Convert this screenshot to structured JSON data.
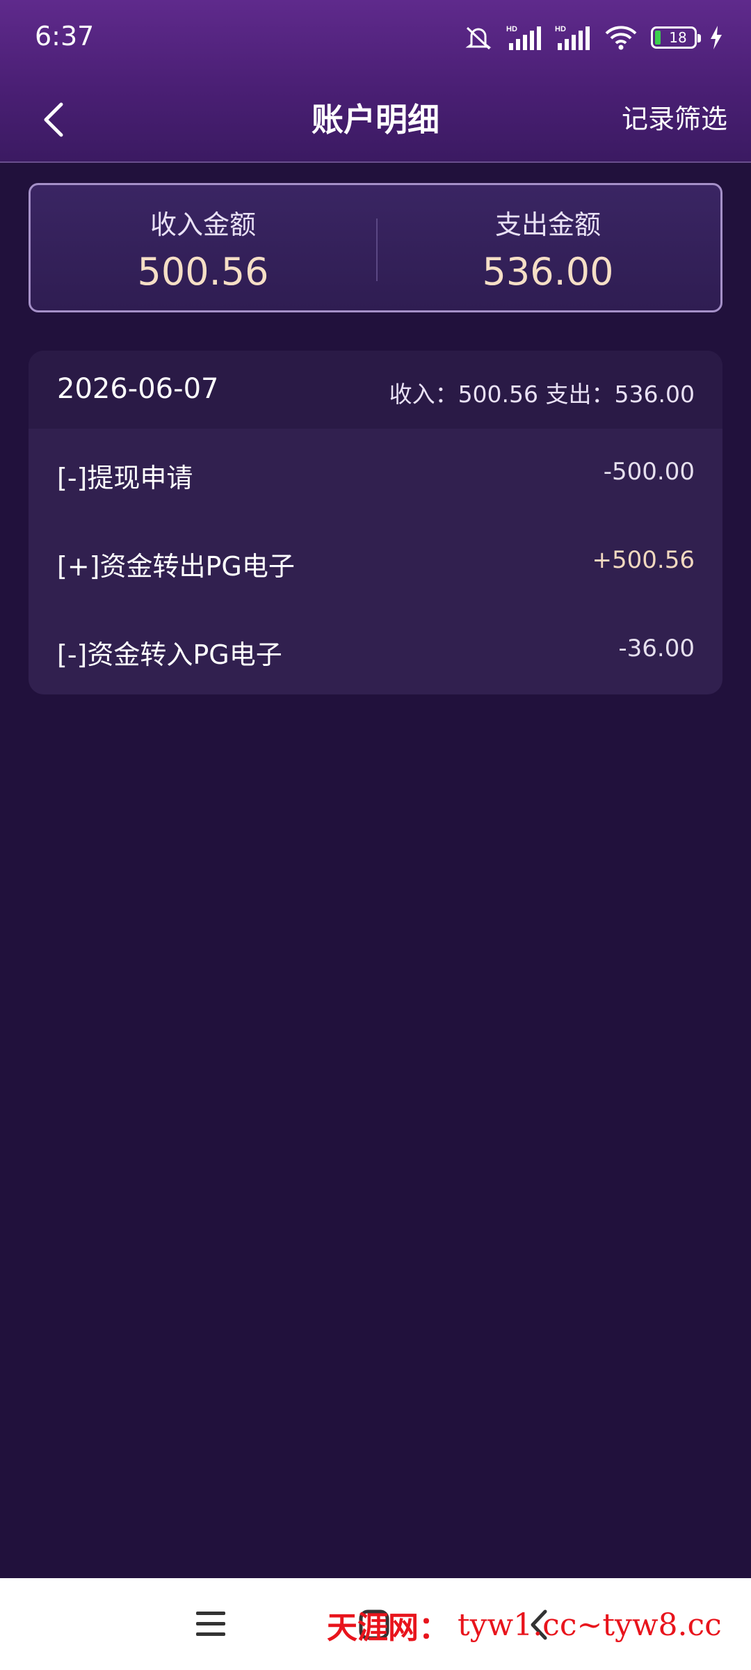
{
  "status_bar": {
    "time": "6:37",
    "battery": "18",
    "icons": [
      "mute-icon",
      "signal-icon",
      "signal-icon",
      "wifi-icon",
      "battery-icon",
      "charging-icon"
    ]
  },
  "header": {
    "title": "账户明细",
    "filter_label": "记录筛选"
  },
  "summary": {
    "income_label": "收入金额",
    "income_value": "500.56",
    "expense_label": "支出金额",
    "expense_value": "536.00"
  },
  "records": {
    "date": "2026-06-07",
    "summary_text": "收入：500.56 支出：536.00",
    "items": [
      {
        "label": "[-]提现申请",
        "amount": "-500.00"
      },
      {
        "label": "[+]资金转出PG电子",
        "amount": "+500.56"
      },
      {
        "label": "[-]资金转入PG电子",
        "amount": "-36.00"
      }
    ]
  },
  "watermark": {
    "site_name": "天涯网：",
    "url": "tyw1.cc~tyw8.cc"
  },
  "colors": {
    "accent": "#f6dfc6",
    "background": "#21113c",
    "header": "#5f2a8c"
  }
}
